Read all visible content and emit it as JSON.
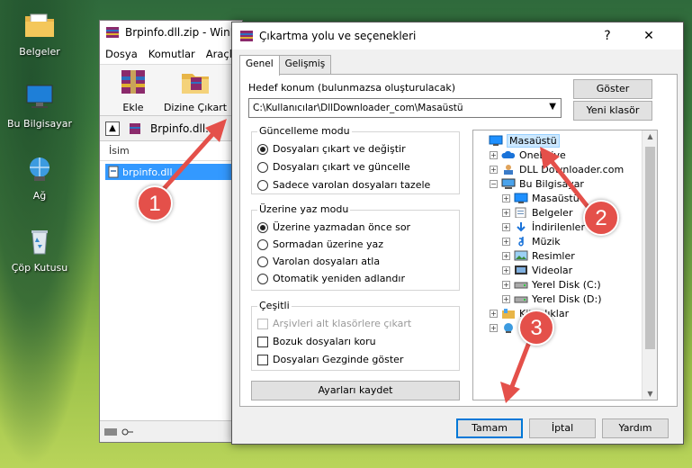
{
  "desktop": {
    "icons": [
      {
        "label": "Belgeler"
      },
      {
        "label": "Bu Bilgisayar"
      },
      {
        "label": "Ağ"
      },
      {
        "label": "Çöp Kutusu"
      }
    ]
  },
  "winrar": {
    "title": "Brpinfo.dll.zip - WinR",
    "menu": [
      "Dosya",
      "Komutlar",
      "Araçla"
    ],
    "toolbar": {
      "add": "Ekle",
      "extract": "Dizine Çıkart"
    },
    "path": "Brpinfo.dll.za",
    "column_name": "İsim",
    "file": "brpinfo.dll"
  },
  "dialog": {
    "title": "Çıkartma yolu ve seçenekleri",
    "help_btn": "?",
    "close_btn": "✕",
    "tabs": [
      "Genel",
      "Gelişmiş"
    ],
    "dest_label": "Hedef konum (bulunmazsa oluşturulacak)",
    "dest_value": "C:\\Kullanıcılar\\DllDownloader_com\\Masaüstü",
    "show_btn": "Göster",
    "new_folder_btn": "Yeni klasör",
    "update_group": {
      "title": "Güncelleme modu",
      "options": [
        "Dosyaları çıkart ve değiştir",
        "Dosyaları çıkart ve güncelle",
        "Sadece varolan dosyaları tazele"
      ],
      "selected": 0
    },
    "overwrite_group": {
      "title": "Üzerine yaz modu",
      "options": [
        "Üzerine yazmadan önce sor",
        "Sormadan üzerine yaz",
        "Varolan dosyaları atla",
        "Otomatik yeniden adlandır"
      ],
      "selected": 0
    },
    "misc_group": {
      "title": "Çeşitli",
      "options": [
        "Arşivleri alt klasörlere çıkart",
        "Bozuk dosyaları koru",
        "Dosyaları Gezginde göster"
      ]
    },
    "save_btn": "Ayarları kaydet",
    "tree": [
      {
        "label": "Masaüstü",
        "indent": 0,
        "icon": "desktop-icon",
        "expander": "",
        "selected": true
      },
      {
        "label": "OneDrive",
        "indent": 1,
        "icon": "cloud-icon",
        "expander": "+"
      },
      {
        "label": "DLL Downloader.com",
        "indent": 1,
        "icon": "user-folder-icon",
        "expander": "+"
      },
      {
        "label": "Bu Bilgisayar",
        "indent": 1,
        "icon": "computer-icon",
        "expander": "−"
      },
      {
        "label": "Masaüstü",
        "indent": 2,
        "icon": "desktop-icon",
        "expander": "+"
      },
      {
        "label": "Belgeler",
        "indent": 2,
        "icon": "documents-icon",
        "expander": "+"
      },
      {
        "label": "İndirilenler",
        "indent": 2,
        "icon": "download-icon",
        "expander": "+"
      },
      {
        "label": "Müzik",
        "indent": 2,
        "icon": "music-icon",
        "expander": "+"
      },
      {
        "label": "Resimler",
        "indent": 2,
        "icon": "pictures-icon",
        "expander": "+"
      },
      {
        "label": "Videolar",
        "indent": 2,
        "icon": "videos-icon",
        "expander": "+"
      },
      {
        "label": "Yerel Disk (C:)",
        "indent": 2,
        "icon": "drive-icon",
        "expander": "+"
      },
      {
        "label": "Yerel Disk (D:)",
        "indent": 2,
        "icon": "drive-icon",
        "expander": "+"
      },
      {
        "label": "Kitaplıklar",
        "indent": 1,
        "icon": "library-icon",
        "expander": "+"
      },
      {
        "label": "Ağ",
        "indent": 1,
        "icon": "network-icon",
        "expander": "+"
      }
    ],
    "ok_btn": "Tamam",
    "cancel_btn": "İptal",
    "help_text_btn": "Yardım"
  },
  "callouts": [
    "1",
    "2",
    "3"
  ],
  "colors": {
    "callout": "#e4504a",
    "selection": "#3399ff",
    "accent": "#0078d7"
  }
}
